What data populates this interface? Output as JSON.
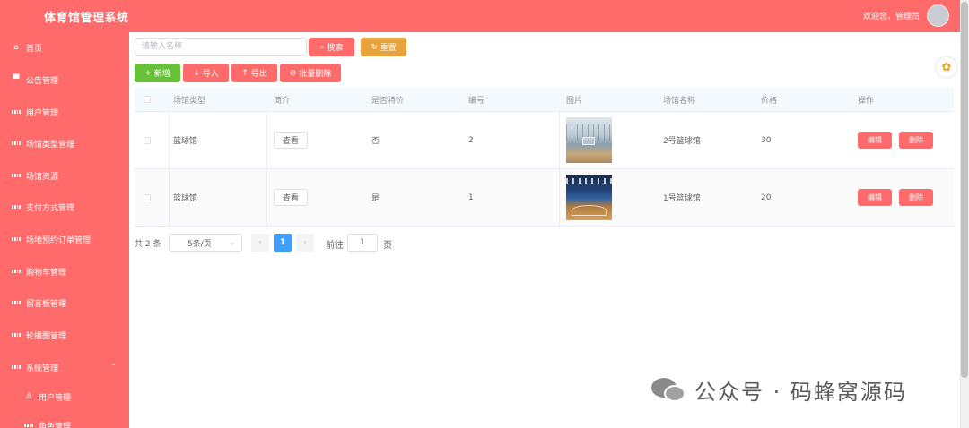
{
  "app": {
    "title": "体育馆管理系统"
  },
  "header": {
    "welcome": "欢迎您，管理员"
  },
  "sidebar": {
    "items": [
      {
        "label": "首页",
        "icon": "home-icon"
      },
      {
        "label": "公告管理",
        "icon": "notice-icon"
      },
      {
        "label": "用户管理",
        "icon": "grid-icon"
      },
      {
        "label": "场馆类型管理",
        "icon": "grid-icon"
      },
      {
        "label": "场馆资源",
        "icon": "grid-icon"
      },
      {
        "label": "支付方式管理",
        "icon": "grid-icon"
      },
      {
        "label": "场地预约订单管理",
        "icon": "grid-icon"
      },
      {
        "label": "购物车管理",
        "icon": "grid-icon"
      },
      {
        "label": "留言板管理",
        "icon": "grid-icon"
      },
      {
        "label": "轮播图管理",
        "icon": "grid-icon"
      },
      {
        "label": "系统管理",
        "icon": "apps-icon"
      },
      {
        "label": "用户管理",
        "icon": "user-icon"
      },
      {
        "label": "角色管理",
        "icon": "grid-icon"
      }
    ]
  },
  "toolbar": {
    "search_placeholder": "请输入名称",
    "search_label": "搜索",
    "reset_label": "重置",
    "add_label": "新增",
    "import_label": "导入",
    "export_label": "导出",
    "batch_delete_label": "批量删除"
  },
  "table": {
    "headers": [
      "场馆类型",
      "简介",
      "是否特价",
      "编号",
      "图片",
      "场馆名称",
      "价格",
      "操作"
    ],
    "view_label": "查看",
    "edit_label": "编辑",
    "delete_label": "删除",
    "rows": [
      {
        "type": "篮球馆",
        "special": "否",
        "number": "2",
        "name": "2号篮球馆",
        "price": "30"
      },
      {
        "type": "篮球馆",
        "special": "是",
        "number": "1",
        "name": "1号篮球馆",
        "price": "20"
      }
    ]
  },
  "pagination": {
    "total_text": "共 2 条",
    "page_size": "5条/页",
    "prev": "‹",
    "next": "›",
    "current_page": "1",
    "goto_prefix": "前往",
    "goto_value": "1",
    "goto_suffix": "页"
  },
  "watermark": {
    "text": "公众号 · 码蜂窝源码"
  },
  "colors": {
    "primary": "#ff6b6b",
    "warning": "#e6a23c",
    "success": "#67c23a",
    "pagination": "#409eff"
  }
}
